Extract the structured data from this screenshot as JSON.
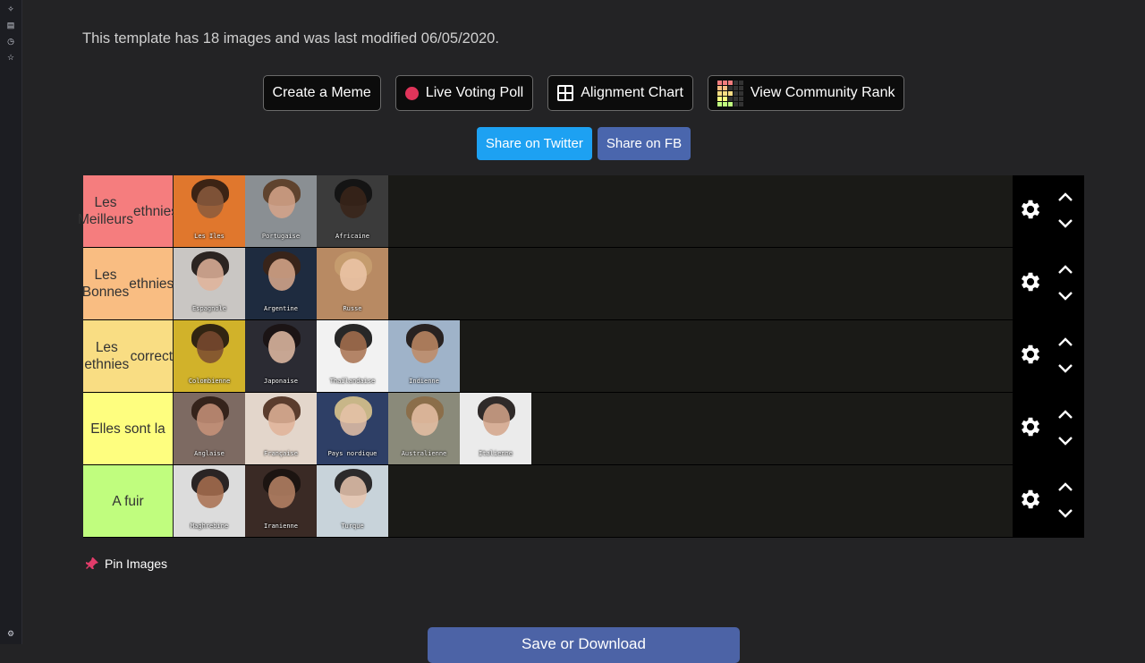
{
  "header": {
    "info_text": "This template has 18 images and was last modified 06/05/2020."
  },
  "actions": {
    "create_meme": "Create a Meme",
    "live_voting_poll": "Live Voting Poll",
    "alignment_chart": "Alignment Chart",
    "view_community_rank": "View Community Rank"
  },
  "share": {
    "twitter": "Share on Twitter",
    "facebook": "Share on FB"
  },
  "tiers": [
    {
      "label_line1": "Les Meilleurs",
      "label_line2": "ethnies",
      "color": "#f57d7e",
      "items": [
        {
          "caption": "Les Iles",
          "bg": "#e0772d",
          "face": "#8a5a3d",
          "hair": "#2a1a12"
        },
        {
          "caption": "Portugaise",
          "bg": "#8a8f93",
          "face": "#d6a589",
          "hair": "#5a3b24"
        },
        {
          "caption": "Africaine",
          "bg": "#3b3b3b",
          "face": "#3a2419",
          "hair": "#111111"
        }
      ]
    },
    {
      "label_line1": "Les Bonnes",
      "label_line2": "ethnies",
      "color": "#f9bd82",
      "items": [
        {
          "caption": "Espagnole",
          "bg": "#c9c6c3",
          "face": "#e0b39a",
          "hair": "#1a1210"
        },
        {
          "caption": "Argentine",
          "bg": "#1e2b3f",
          "face": "#d9a98d",
          "hair": "#3b2416"
        },
        {
          "caption": "Russe",
          "bg": "#b88a63",
          "face": "#ecc6a8",
          "hair": "#c79d6f"
        }
      ]
    },
    {
      "label_line1": "Les ethnies",
      "label_line2": "correct",
      "color": "#f9dd83",
      "items": [
        {
          "caption": "Colombienne",
          "bg": "#d1b22a",
          "face": "#7a4a30",
          "hair": "#1f1410"
        },
        {
          "caption": "Japonaise",
          "bg": "#2b2b33",
          "face": "#e3bca4",
          "hair": "#1a1212"
        },
        {
          "caption": "Thaïlandaise",
          "bg": "#f2f2f2",
          "face": "#a8714f",
          "hair": "#111111"
        },
        {
          "caption": "Indienne",
          "bg": "#9fb3c9",
          "face": "#c08a64",
          "hair": "#1b120e"
        }
      ]
    },
    {
      "label_line1": "Elles sont la",
      "label_line2": "",
      "color": "#fefe7f",
      "items": [
        {
          "caption": "Anglaise",
          "bg": "#7d6a62",
          "face": "#c8937a",
          "hair": "#2e1c14"
        },
        {
          "caption": "Française",
          "bg": "#e3d6cb",
          "face": "#e1b399",
          "hair": "#4a2b1c"
        },
        {
          "caption": "Pays nordique",
          "bg": "#2e3f66",
          "face": "#e5c2a8",
          "hair": "#d9c38c"
        },
        {
          "caption": "Australienne",
          "bg": "#8a8a7a",
          "face": "#e6c0a5",
          "hair": "#8b6a45"
        },
        {
          "caption": "Italienne",
          "bg": "#ebebeb",
          "face": "#d3a48a",
          "hair": "#1b1514"
        }
      ]
    },
    {
      "label_line1": "A fuir",
      "label_line2": "",
      "color": "#c0fd7e",
      "items": [
        {
          "caption": "Maghrebine",
          "bg": "#dcdcdc",
          "face": "#a86f4f",
          "hair": "#161010"
        },
        {
          "caption": "Iranienne",
          "bg": "#3a2a25",
          "face": "#b88466",
          "hair": "#1a120f"
        },
        {
          "caption": "Turque",
          "bg": "#c8d3da",
          "face": "#e7c4ae",
          "hair": "#1b1717"
        }
      ]
    }
  ],
  "footer": {
    "pin_images": "Pin Images",
    "save_or_download": "Save or Download"
  }
}
